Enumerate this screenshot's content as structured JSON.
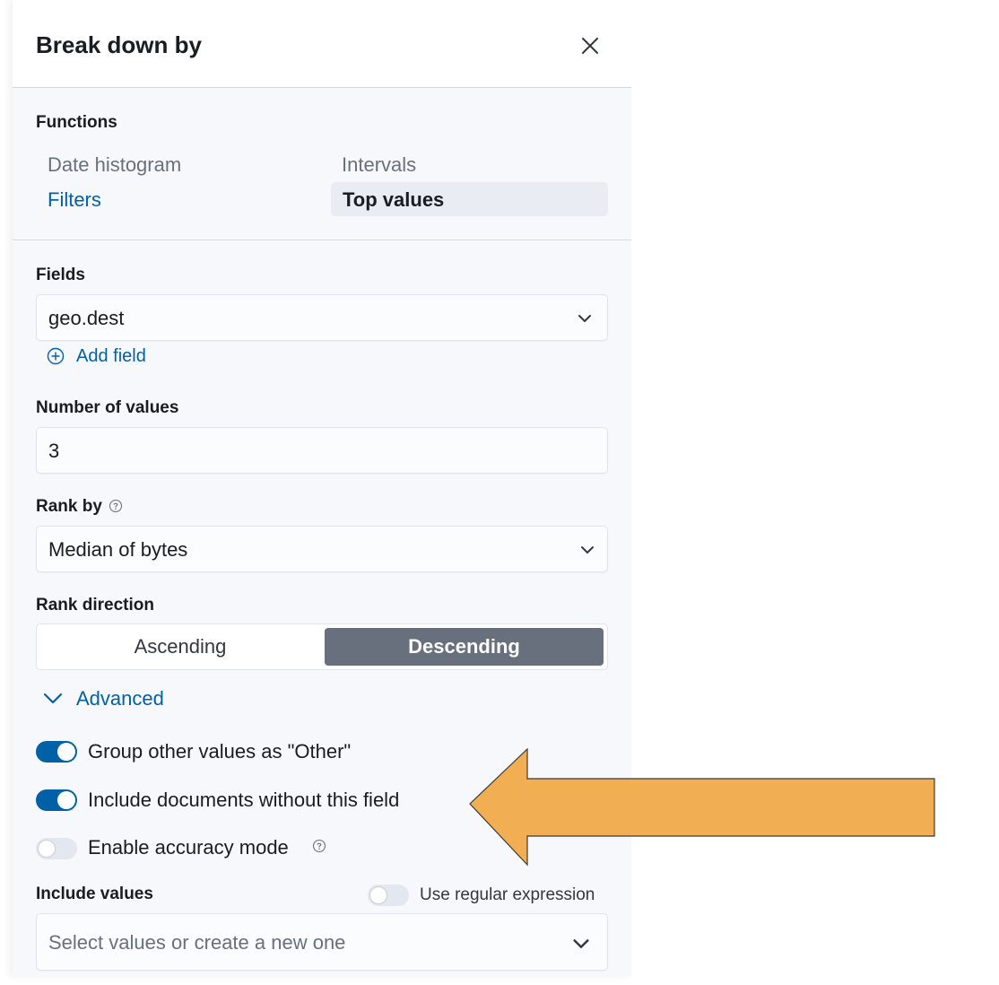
{
  "flyout": {
    "title": "Break down by"
  },
  "functions": {
    "label": "Functions",
    "items": [
      "Date histogram",
      "Intervals",
      "Filters",
      "Top values"
    ],
    "selected": "Top values"
  },
  "fields": {
    "label": "Fields",
    "value": "geo.dest",
    "add_label": "Add field"
  },
  "number_of_values": {
    "label": "Number of values",
    "value": "3"
  },
  "rank_by": {
    "label": "Rank by",
    "value": "Median of bytes"
  },
  "rank_direction": {
    "label": "Rank direction",
    "options": [
      "Ascending",
      "Descending"
    ],
    "selected": "Descending"
  },
  "advanced": {
    "label": "Advanced",
    "expanded": true
  },
  "toggles": [
    {
      "label": "Group other values as \"Other\"",
      "on": true
    },
    {
      "label": "Include documents without this field",
      "on": true
    },
    {
      "label": "Enable accuracy mode",
      "on": false
    }
  ],
  "include_values": {
    "label": "Include values",
    "regex_label": "Use regular expression",
    "regex_on": false,
    "placeholder": "Select values or create a new one"
  },
  "colors": {
    "link": "#0061a6",
    "panel_bg": "#f7f8fc",
    "selected_button": "#69707d",
    "annotation_arrow": "#f2ae52"
  }
}
